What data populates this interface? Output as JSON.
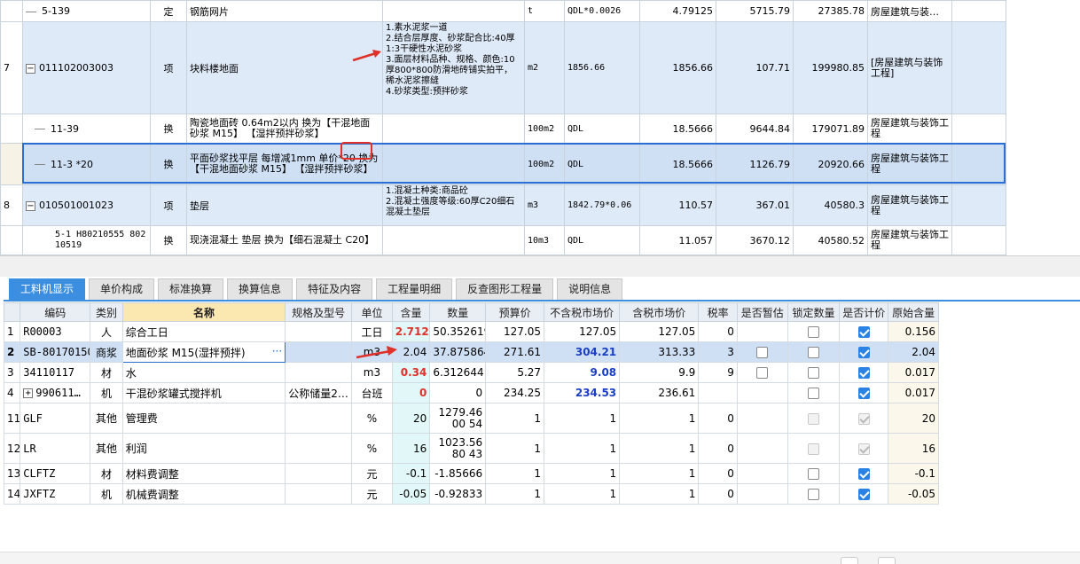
{
  "top_rows": [
    {
      "rownum": "",
      "code": "5-139",
      "type": "定",
      "name": "钢筋网片",
      "features": "",
      "unit": "t",
      "expr": "QDL*0.0026",
      "qty": "4.79125",
      "price": "5715.79",
      "total": "27385.78",
      "major": "房屋建筑与装…"
    },
    {
      "rownum": "7",
      "code": "011102003003",
      "type": "项",
      "name": "块料楼地面",
      "features": "1.素水泥浆一道\n2.结合层厚度、砂浆配合比:40厚1:3干硬性水泥砂浆\n3.面层材料品种、规格、颜色:10厚800*800防滑地砖铺实拍平，稀水泥浆擦缝\n4.砂浆类型:预拌砂浆",
      "unit": "m2",
      "expr": "1856.66",
      "qty": "1856.66",
      "price": "107.71",
      "total": "199980.85",
      "major": "[房屋建筑与装饰工程]"
    },
    {
      "rownum": "",
      "code": "11-39",
      "type": "换",
      "name": "陶瓷地面砖 0.64m2以内  换为【干混地面砂浆 M15】 【湿拌预拌砂浆】",
      "features": "",
      "unit": "100m2",
      "expr": "QDL",
      "qty": "18.5666",
      "price": "9644.84",
      "total": "179071.89",
      "major": "房屋建筑与装饰工程"
    },
    {
      "rownum": "",
      "code": "11-3 *20",
      "type": "换",
      "name": "平面砂浆找平层 每增减1mm  单价*20 换为【干混地面砂浆 M15】 【湿拌预拌砂浆】",
      "features": "",
      "unit": "100m2",
      "expr": "QDL",
      "qty": "18.5666",
      "price": "1126.79",
      "total": "20920.66",
      "major": "房屋建筑与装饰工程"
    },
    {
      "rownum": "8",
      "code": "010501001023",
      "type": "项",
      "name": "垫层",
      "features": "1.混凝土种类:商品砼\n2.混凝土强度等级:60厚C20细石混凝土垫层",
      "unit": "m3",
      "expr": "1842.79*0.06",
      "qty": "110.57",
      "price": "367.01",
      "total": "40580.3",
      "major": "房屋建筑与装饰工程"
    },
    {
      "rownum": "",
      "code": "5-1 H80210555 80210519",
      "type": "换",
      "name": "现浇混凝土 垫层  换为【细石混凝土 C20】",
      "features": "",
      "unit": "10m3",
      "expr": "QDL",
      "qty": "11.057",
      "price": "3670.12",
      "total": "40580.52",
      "major": "房屋建筑与装饰工程"
    }
  ],
  "tabs": [
    "工料机显示",
    "单价构成",
    "标准换算",
    "换算信息",
    "特征及内容",
    "工程量明细",
    "反查图形工程量",
    "说明信息"
  ],
  "columns": [
    "编码",
    "类别",
    "名称",
    "规格及型号",
    "单位",
    "含量",
    "数量",
    "预算价",
    "不含税市场价",
    "含税市场价",
    "税率",
    "是否暂估",
    "锁定数量",
    "是否计价",
    "原始含量"
  ],
  "rows": [
    {
      "rn": "1",
      "code": "R00003",
      "cat": "人",
      "name": "综合工日",
      "spec": "",
      "unit": "工日",
      "content": "2.712",
      "qty": "50.352619",
      "budget": "127.05",
      "mkt": "127.05",
      "mkt_tax": "127.05",
      "rate": "0",
      "orig": "0.156"
    },
    {
      "rn": "2",
      "code": "SB-80170150",
      "cat": "商浆",
      "name": "地面砂浆 M15(湿拌预拌)",
      "spec": "",
      "unit": "m3",
      "content": "2.04",
      "qty": "37.875864",
      "budget": "271.61",
      "mkt": "304.21",
      "mkt_tax": "313.33",
      "rate": "3",
      "orig": "2.04"
    },
    {
      "rn": "3",
      "code": "34110117",
      "cat": "材",
      "name": "水",
      "spec": "",
      "unit": "m3",
      "content": "0.34",
      "qty": "6.312644",
      "budget": "5.27",
      "mkt": "9.08",
      "mkt_tax": "9.9",
      "rate": "9",
      "orig": "0.017"
    },
    {
      "rn": "4",
      "code": "990611…",
      "cat": "机",
      "name": "干混砂浆罐式搅拌机",
      "spec": "公称储量2…",
      "unit": "台班",
      "content": "0",
      "qty": "0",
      "budget": "234.25",
      "mkt": "234.53",
      "mkt_tax": "236.61",
      "rate": "",
      "orig": "0.017"
    },
    {
      "rn": "11",
      "code": "GLF",
      "cat": "其他",
      "name": "管理费",
      "spec": "",
      "unit": "%",
      "content": "20",
      "qty": "1279.4600 54",
      "budget": "1",
      "mkt": "1",
      "mkt_tax": "1",
      "rate": "0",
      "orig": "20"
    },
    {
      "rn": "12",
      "code": "LR",
      "cat": "其他",
      "name": "利润",
      "spec": "",
      "unit": "%",
      "content": "16",
      "qty": "1023.5680 43",
      "budget": "1",
      "mkt": "1",
      "mkt_tax": "1",
      "rate": "0",
      "orig": "16"
    },
    {
      "rn": "13",
      "code": "CLFTZ",
      "cat": "材",
      "name": "材料费调整",
      "spec": "",
      "unit": "元",
      "content": "-0.1",
      "qty": "-1.85666",
      "budget": "1",
      "mkt": "1",
      "mkt_tax": "1",
      "rate": "0",
      "orig": "-0.1"
    },
    {
      "rn": "14",
      "code": "JXFTZ",
      "cat": "机",
      "name": "机械费调整",
      "spec": "",
      "unit": "元",
      "content": "-0.05",
      "qty": "-0.92833",
      "budget": "1",
      "mkt": "1",
      "mkt_tax": "1",
      "rate": "0",
      "orig": "-0.05"
    }
  ],
  "icons": {
    "collapse": "minus-box-icon",
    "expand": "plus-box-icon",
    "more": "ellipsis-icon",
    "arrow": "red-arrow-icon"
  },
  "colors": {
    "accent": "#3b8ee0",
    "highlight": "#e0302a",
    "selected_row": "#cfe0f5",
    "bill_row": "#dfeaf8"
  }
}
